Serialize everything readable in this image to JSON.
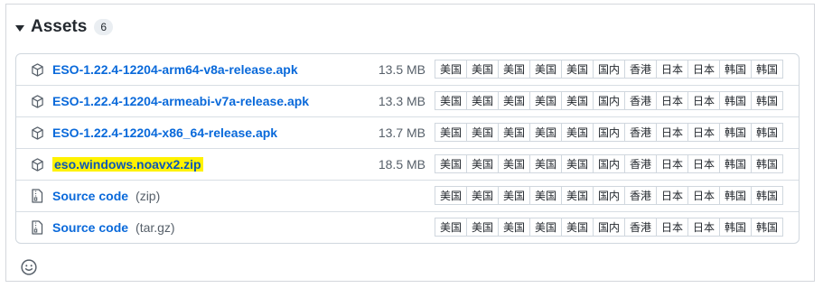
{
  "header": {
    "title": "Assets",
    "count": "6"
  },
  "assets": [
    {
      "name": "ESO-1.22.4-12204-arm64-v8a-release.apk",
      "format": "",
      "size": "13.5 MB",
      "icon": "package-icon",
      "highlighted": false,
      "mirrors": [
        "美国",
        "美国",
        "美国",
        "美国",
        "美国",
        "国内",
        "香港",
        "日本",
        "日本",
        "韩国",
        "韩国"
      ]
    },
    {
      "name": "ESO-1.22.4-12204-armeabi-v7a-release.apk",
      "format": "",
      "size": "13.3 MB",
      "icon": "package-icon",
      "highlighted": false,
      "mirrors": [
        "美国",
        "美国",
        "美国",
        "美国",
        "美国",
        "国内",
        "香港",
        "日本",
        "日本",
        "韩国",
        "韩国"
      ]
    },
    {
      "name": "ESO-1.22.4-12204-x86_64-release.apk",
      "format": "",
      "size": "13.7 MB",
      "icon": "package-icon",
      "highlighted": false,
      "mirrors": [
        "美国",
        "美国",
        "美国",
        "美国",
        "美国",
        "国内",
        "香港",
        "日本",
        "日本",
        "韩国",
        "韩国"
      ]
    },
    {
      "name": "eso.windows.noavx2.zip",
      "format": "",
      "size": "18.5 MB",
      "icon": "package-icon",
      "highlighted": true,
      "highlight_color": "#fff200",
      "mirrors": [
        "美国",
        "美国",
        "美国",
        "美国",
        "美国",
        "国内",
        "香港",
        "日本",
        "日本",
        "韩国",
        "韩国"
      ]
    },
    {
      "name": "Source code",
      "format": "(zip)",
      "size": "",
      "icon": "file-zip-icon",
      "highlighted": false,
      "mirrors": [
        "美国",
        "美国",
        "美国",
        "美国",
        "美国",
        "国内",
        "香港",
        "日本",
        "日本",
        "韩国",
        "韩国"
      ]
    },
    {
      "name": "Source code",
      "format": "(tar.gz)",
      "size": "",
      "icon": "file-zip-icon",
      "highlighted": false,
      "mirrors": [
        "美国",
        "美国",
        "美国",
        "美国",
        "美国",
        "国内",
        "香港",
        "日本",
        "日本",
        "韩国",
        "韩国"
      ]
    }
  ],
  "footer": {
    "reaction_icon": "smiley-icon"
  },
  "colors": {
    "link": "#0969da",
    "muted": "#57606a",
    "border": "#d0d7de",
    "highlight": "#fff200"
  }
}
